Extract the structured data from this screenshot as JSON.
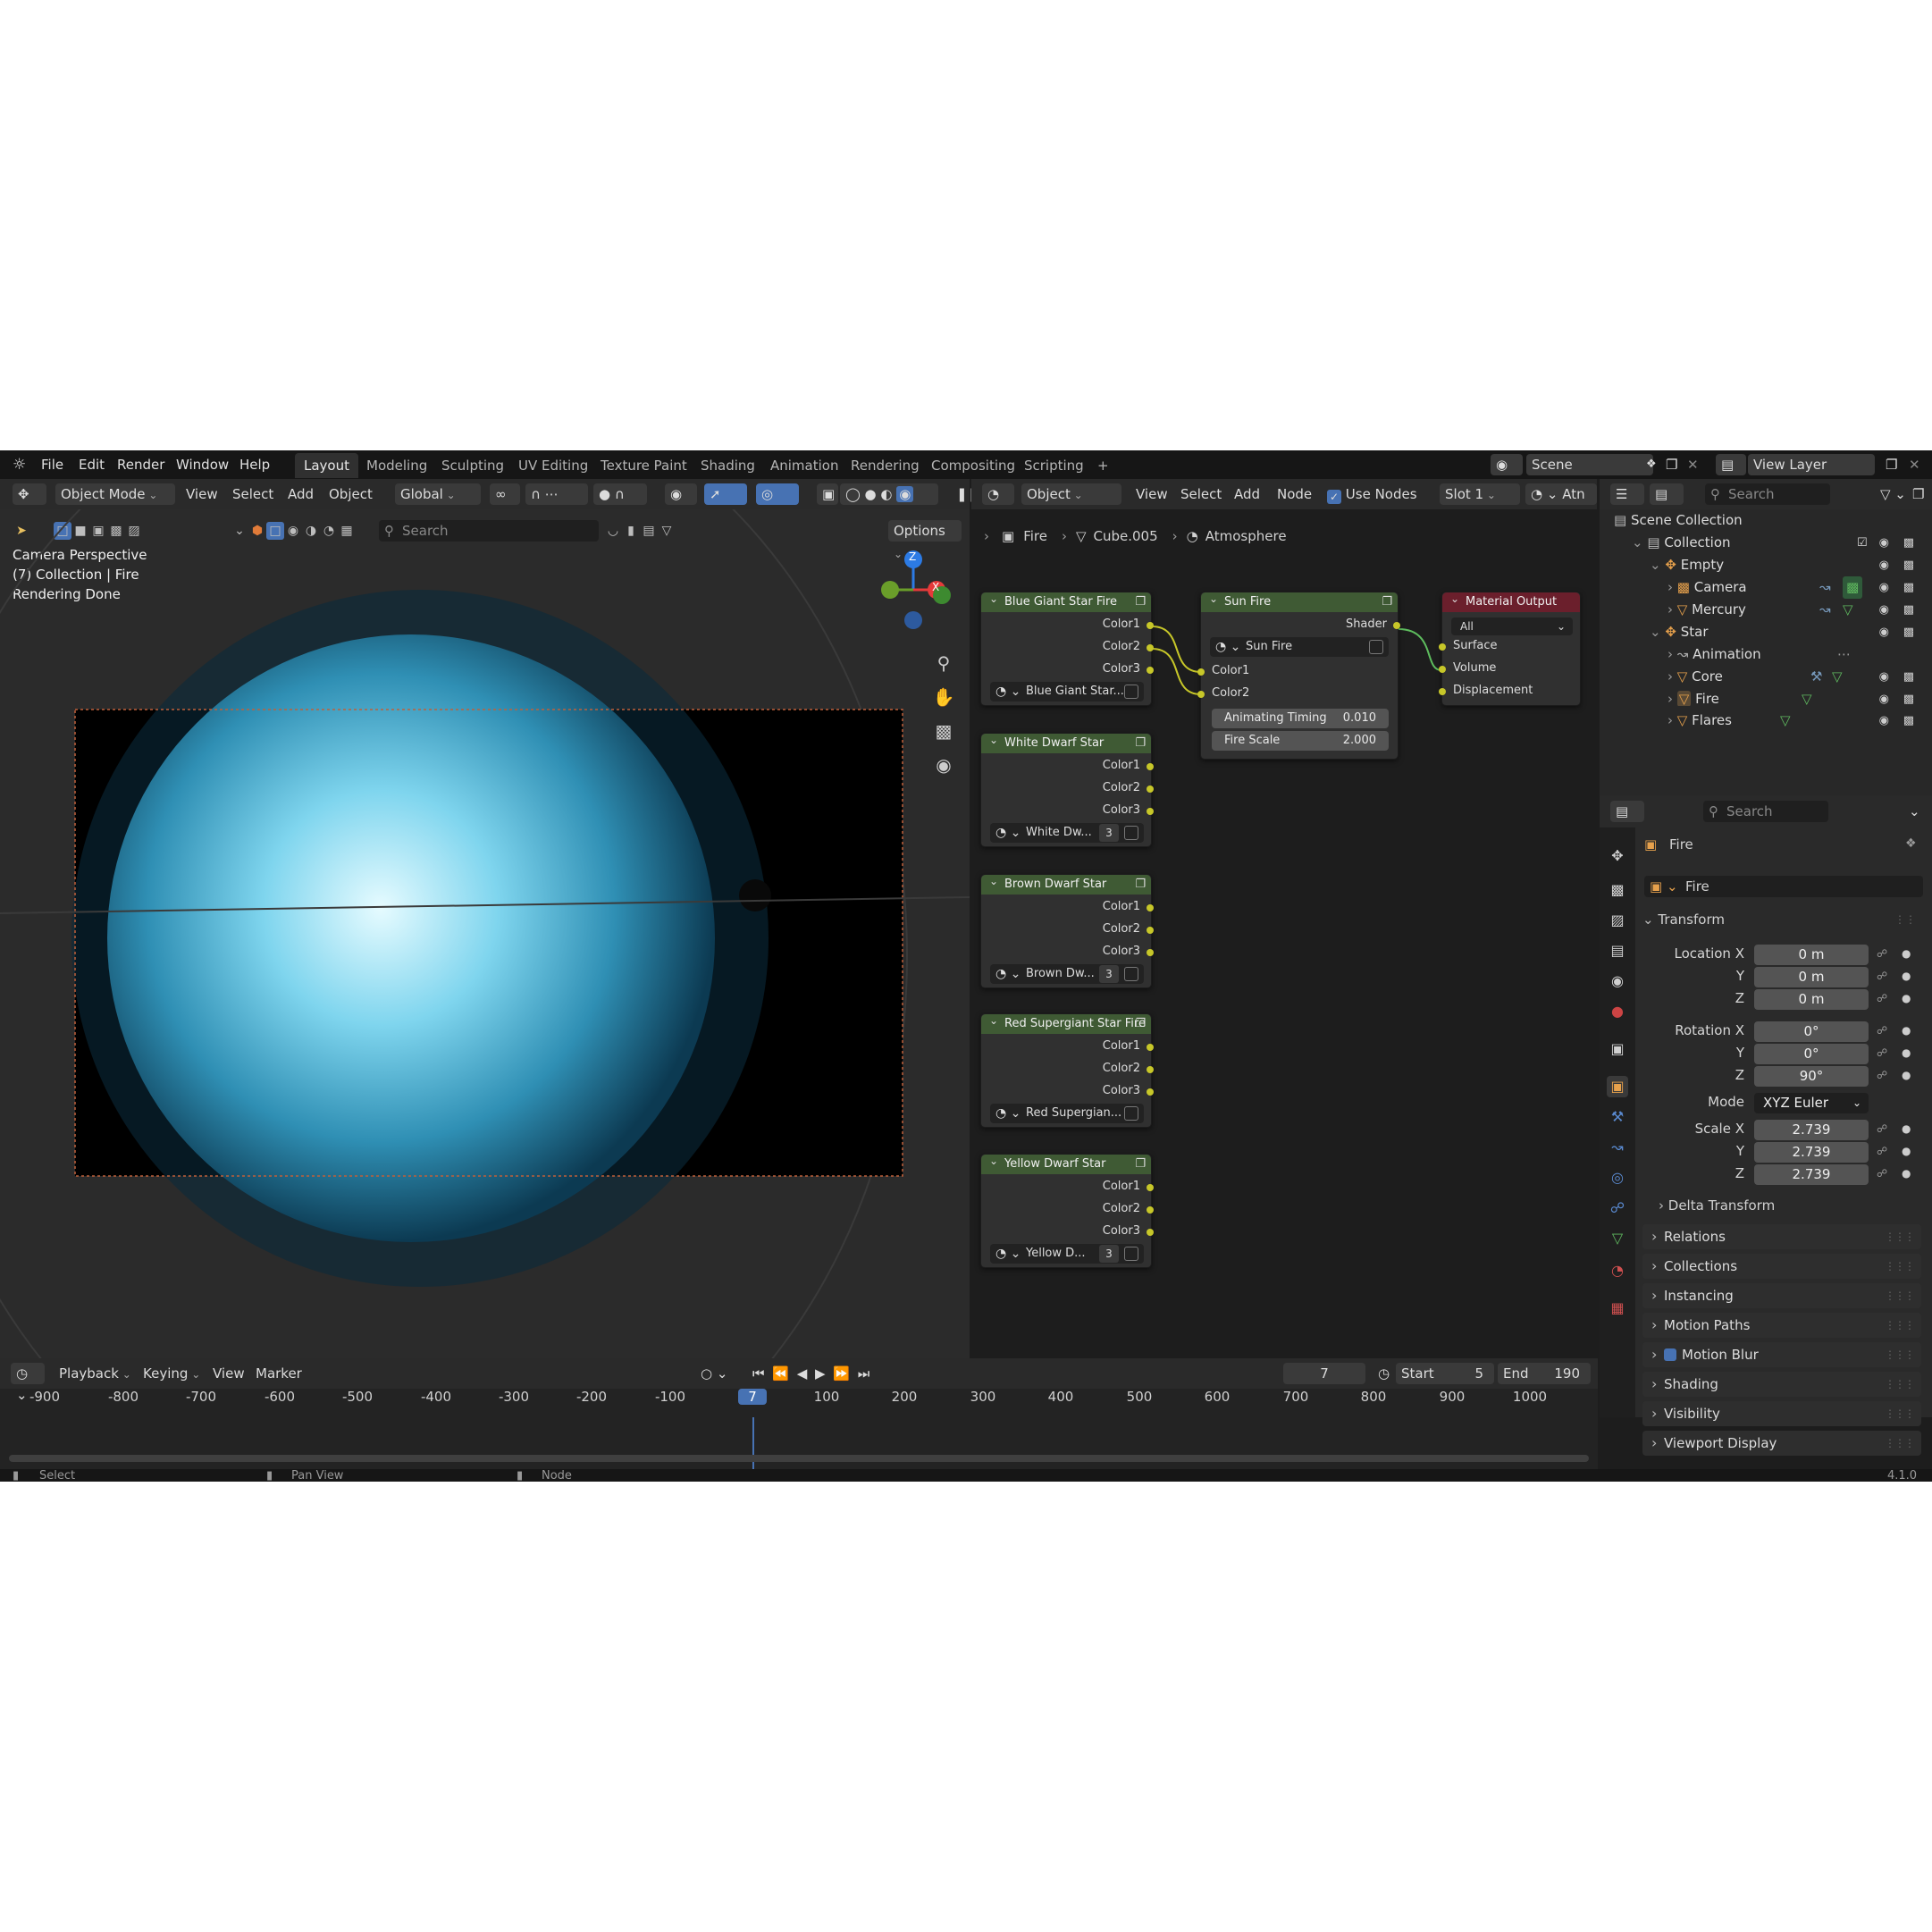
{
  "topbar": {
    "menus": [
      "File",
      "Edit",
      "Render",
      "Window",
      "Help"
    ],
    "workspaces": [
      "Layout",
      "Modeling",
      "Sculpting",
      "UV Editing",
      "Texture Paint",
      "Shading",
      "Animation",
      "Rendering",
      "Compositing",
      "Scripting"
    ],
    "active_workspace": "Layout",
    "add_tab": "+",
    "scene": "Scene",
    "view_layer": "View Layer"
  },
  "viewport_header": {
    "mode": "Object Mode",
    "menus": [
      "View",
      "Select",
      "Add",
      "Object"
    ],
    "orientation": "Global",
    "search_placeholder": "Search",
    "options": "Options"
  },
  "viewport": {
    "line1": "Camera Perspective",
    "line2": "(7) Collection | Fire",
    "line3": "Rendering Done",
    "gizmo": {
      "z": "Z",
      "x": "X"
    }
  },
  "node_header": {
    "type": "Object",
    "menus": [
      "View",
      "Select",
      "Add",
      "Node"
    ],
    "use_nodes": "Use Nodes",
    "slot": "Slot 1",
    "material_trunc": "Atn",
    "breadcrumb": [
      "Fire",
      "Cube.005",
      "Atmosphere"
    ]
  },
  "nodes": {
    "groups": [
      {
        "title": "Blue Giant Star Fire",
        "sel": "Blue Giant Star...",
        "count": ""
      },
      {
        "title": "White Dwarf Star",
        "sel": "White Dw...",
        "count": "3"
      },
      {
        "title": "Brown Dwarf Star",
        "sel": "Brown Dw...",
        "count": "3"
      },
      {
        "title": "Red Supergiant Star Fire",
        "sel": "Red Supergian...",
        "count": ""
      },
      {
        "title": "Yellow Dwarf Star",
        "sel": "Yellow D...",
        "count": "3"
      }
    ],
    "outputs": [
      "Color1",
      "Color2",
      "Color3"
    ],
    "sun_fire": {
      "title": "Sun Fire",
      "out": "Shader",
      "sel": "Sun Fire",
      "in1": "Color1",
      "in2": "Color2",
      "anim_label": "Animating Timing",
      "anim_value": "0.010",
      "scale_label": "Fire Scale",
      "scale_value": "2.000"
    },
    "material_output": {
      "title": "Material Output",
      "target": "All",
      "inputs": [
        "Surface",
        "Volume",
        "Displacement"
      ]
    }
  },
  "outliner": {
    "search_placeholder": "Search",
    "items": [
      "Scene Collection",
      "Collection",
      "Empty",
      "Camera",
      "Mercury",
      "Star",
      "Animation",
      "Core",
      "Fire",
      "Flares"
    ]
  },
  "properties": {
    "search_placeholder": "Search",
    "object_name": "Fire",
    "data_name": "Fire",
    "transform": "Transform",
    "location_label": "Location X",
    "rotation_label": "Rotation X",
    "scale_label": "Scale X",
    "y": "Y",
    "z": "Z",
    "loc": [
      "0 m",
      "0 m",
      "0 m"
    ],
    "rot": [
      "0°",
      "0°",
      "90°"
    ],
    "mode_label": "Mode",
    "mode": "XYZ Euler",
    "scale": [
      "2.739",
      "2.739",
      "2.739"
    ],
    "delta": "Delta Transform",
    "sections": [
      "Relations",
      "Collections",
      "Instancing",
      "Motion Paths",
      "Motion Blur",
      "Shading",
      "Visibility",
      "Viewport Display"
    ]
  },
  "timeline": {
    "menus": [
      "Playback",
      "Keying",
      "View",
      "Marker"
    ],
    "current": "7",
    "start_label": "Start",
    "start": "5",
    "end_label": "End",
    "end": "190",
    "ticks": [
      "-900",
      "-800",
      "-700",
      "-600",
      "-500",
      "-400",
      "-300",
      "-200",
      "-100",
      "7",
      "100",
      "200",
      "300",
      "400",
      "500",
      "600",
      "700",
      "800",
      "900",
      "1000"
    ]
  },
  "statusbar": {
    "select": "Select",
    "pan": "Pan View",
    "node": "Node",
    "version": "4.1.0"
  },
  "colors": {
    "accent": "#4772b3",
    "node_group_header": "#3f5a34",
    "output_header": "#6b1f2c",
    "socket_color": "#c7c729"
  }
}
